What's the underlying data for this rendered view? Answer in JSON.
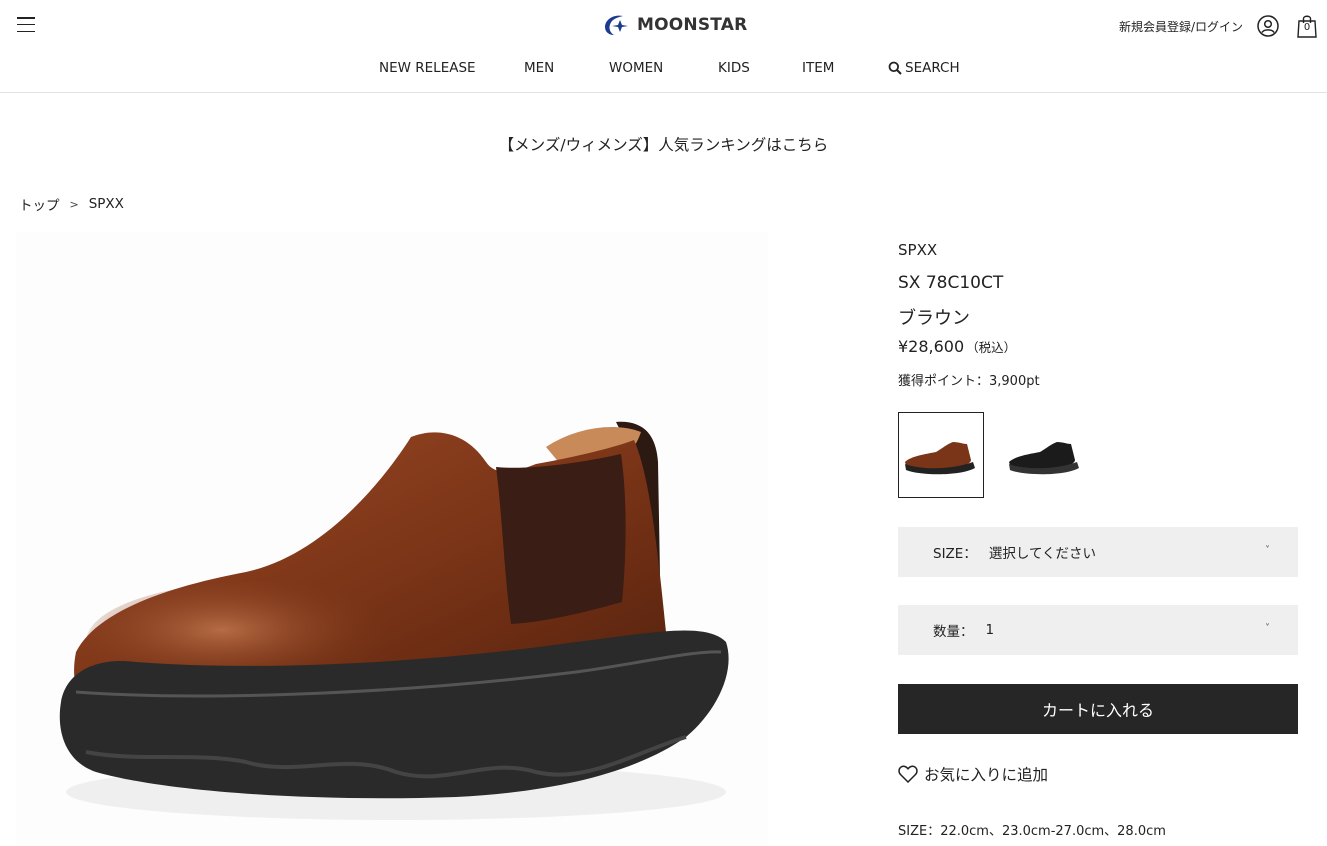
{
  "header": {
    "menu_icon": "hamburger-icon",
    "logo_text": "MOONSTAR",
    "login_label": "新規会員登録/ログイン",
    "user_icon": "user-icon",
    "cart_icon": "shopping-bag-icon",
    "cart_count": "0"
  },
  "nav": {
    "items": [
      {
        "label": "NEW RELEASE"
      },
      {
        "label": "MEN"
      },
      {
        "label": "WOMEN"
      },
      {
        "label": "KIDS"
      },
      {
        "label": "ITEM"
      }
    ],
    "search_label": "SEARCH",
    "search_icon": "search-icon"
  },
  "banner": "【メンズ/ウィメンズ】人気ランキングはこちら",
  "breadcrumb": {
    "items": [
      "トップ",
      "SPXX"
    ],
    "separator": ">"
  },
  "product": {
    "brand": "SPXX",
    "model": "SX 78C10CT",
    "color": "ブラウン",
    "price": "¥28,600",
    "tax_note": "（税込）",
    "points": "獲得ポイント：3,900pt",
    "swatches": [
      {
        "color": "brown",
        "selected": true
      },
      {
        "color": "black",
        "selected": false
      }
    ],
    "size_label": "SIZE：",
    "size_value": "選択してください",
    "qty_label": "数量：",
    "qty_value": "1",
    "cart_button": "カートに入れる",
    "favorite_label": "お気に入りに追加",
    "favorite_icon": "heart-icon",
    "size_range": "SIZE：22.0cm、23.0cm-27.0cm、28.0cm"
  },
  "colors": {
    "accent": "#262626",
    "logo_blue": "#1a3b8f",
    "select_bg": "#efefef"
  }
}
